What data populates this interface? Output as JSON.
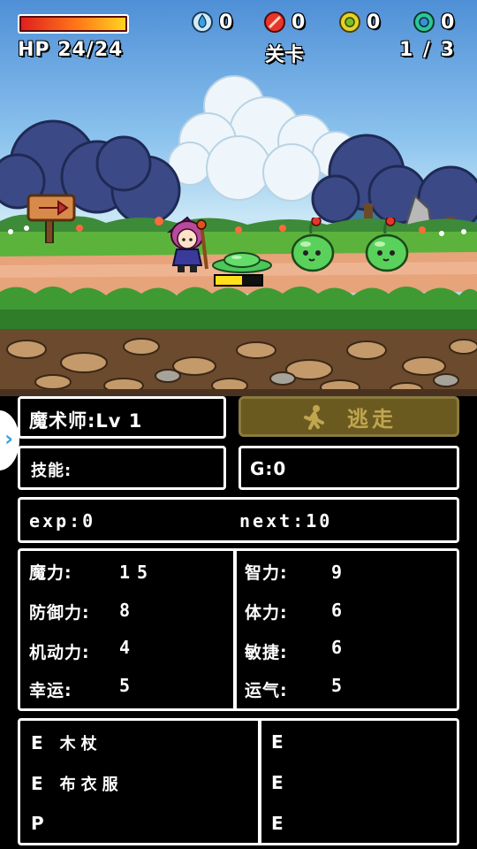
{
  "hud": {
    "hp_fill": 1.0,
    "hp_text": "HP 24/24",
    "gems": [
      {
        "name": "water-gem",
        "count": "0",
        "color": "#8ed3f5"
      },
      {
        "name": "fire-gem",
        "count": "0",
        "color": "#e8352a"
      },
      {
        "name": "earth-gem",
        "count": "0",
        "color": "#e7d12a"
      },
      {
        "name": "wind-gem",
        "count": "0",
        "color": "#2fc59a"
      }
    ],
    "stage_label": "关卡",
    "stage_progress": "1 / 3"
  },
  "battle": {
    "enemy_hp_fill": 0.58
  },
  "character": {
    "class_level": "魔术师:Lv 1",
    "skills_label": "技能:",
    "gold": "G:0",
    "exp": "exp:0",
    "next": "next:10"
  },
  "flee_button": {
    "label": "逃走"
  },
  "stats": {
    "left": [
      {
        "label": "魔力:",
        "value": "15"
      },
      {
        "label": "防御力:",
        "value": "8"
      },
      {
        "label": "机动力:",
        "value": "4"
      },
      {
        "label": "幸运:",
        "value": "5"
      }
    ],
    "right": [
      {
        "label": "智力:",
        "value": "9"
      },
      {
        "label": "体力:",
        "value": "6"
      },
      {
        "label": "敏捷:",
        "value": "6"
      },
      {
        "label": "运气:",
        "value": "5"
      }
    ]
  },
  "equipment": {
    "left": [
      {
        "slot": "E",
        "item": "木杖"
      },
      {
        "slot": "E",
        "item": "布衣服"
      },
      {
        "slot": "P",
        "item": ""
      }
    ],
    "right": [
      {
        "slot": "E",
        "item": ""
      },
      {
        "slot": "E",
        "item": ""
      },
      {
        "slot": "E",
        "item": ""
      }
    ]
  },
  "colors": {
    "panel_border": "#ffffff",
    "flee_bg": "#6b5a20",
    "flee_text": "#bfa64f"
  }
}
